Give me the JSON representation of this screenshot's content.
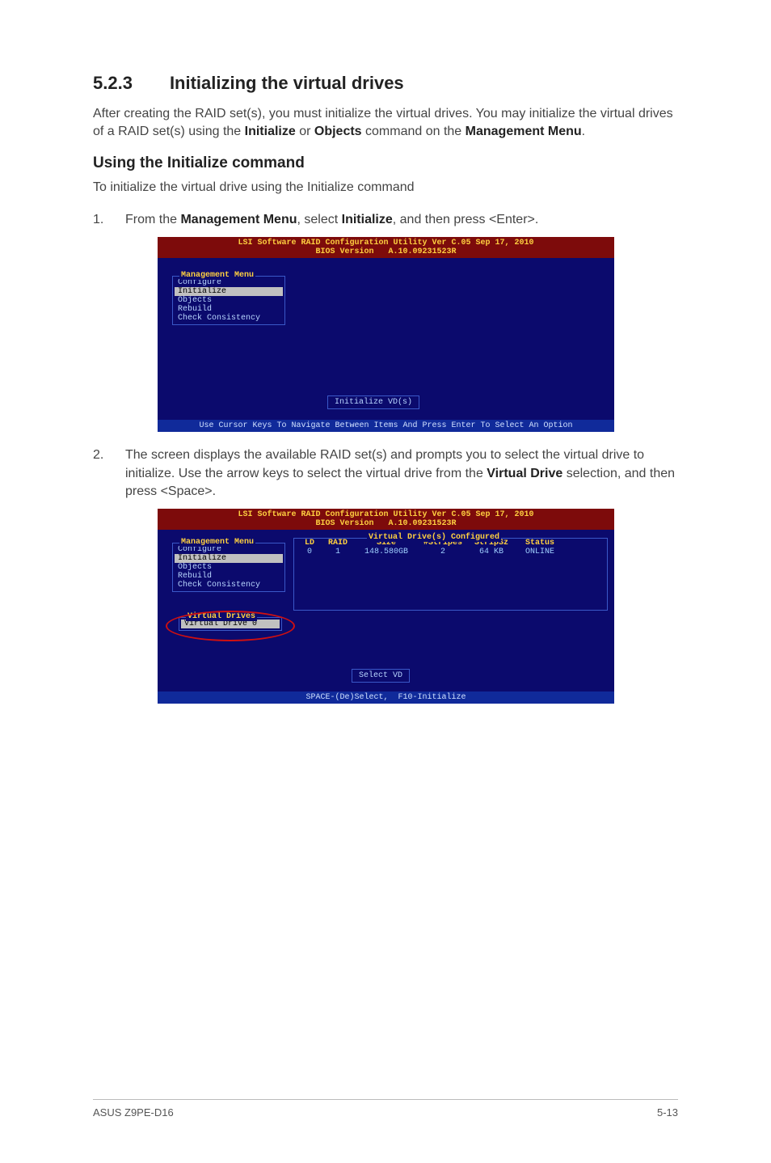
{
  "heading": {
    "number": "5.2.3",
    "title": "Initializing the virtual drives"
  },
  "intro": {
    "before_bold1": "After creating the RAID set(s), you must initialize the virtual drives. You may initialize the virtual drives of a RAID set(s) using the ",
    "bold1": "Initialize",
    "mid1": " or ",
    "bold2": "Objects",
    "mid2": " command on the ",
    "bold3": "Management Menu",
    "after": "."
  },
  "subheading": "Using the Initialize command",
  "sub_intro": "To initialize the virtual drive using the Initialize command",
  "step1": {
    "before": "From the ",
    "b1": "Management Menu",
    "mid1": ", select ",
    "b2": "Initialize",
    "after": ", and then press <Enter>."
  },
  "step2": {
    "line": "The screen displays the available RAID set(s) and prompts you to select the virtual drive to initialize. Use the arrow keys to select the virtual drive from the ",
    "b1": "Virtual Drive",
    "after": " selection, and then press <Space>."
  },
  "bios": {
    "title_line1": "LSI Software RAID Configuration Utility Ver C.05 Sep 17, 2010",
    "title_line2": "BIOS Version   A.10.09231523R",
    "mgmt_legend": "Management Menu",
    "mgmt_items": [
      "Configure",
      "Initialize",
      "Objects",
      "Rebuild",
      "Check Consistency"
    ],
    "center_button1": "Initialize VD(s)",
    "footer1": "Use Cursor Keys To Navigate Between Items And Press Enter To Select An Option",
    "vd_config_legend": "Virtual Drive(s) Configured",
    "vd_header": {
      "ld": "LD",
      "raid": "RAID",
      "size": "Size",
      "stripes": "#Stripes",
      "stripsz": "StripSz",
      "status": "Status"
    },
    "vd_row": {
      "ld": "0",
      "raid": "1",
      "size": "148.580GB",
      "stripes": "2",
      "stripsz": "64 KB",
      "status": "ONLINE"
    },
    "vdrives_legend": "Virtual Drives",
    "vdrives_item": "Virtual Drive 0",
    "center_button2": "Select VD",
    "footer2": "SPACE-(De)Select,  F10-Initialize"
  },
  "footer": {
    "left": "ASUS Z9PE-D16",
    "right": "5-13"
  }
}
